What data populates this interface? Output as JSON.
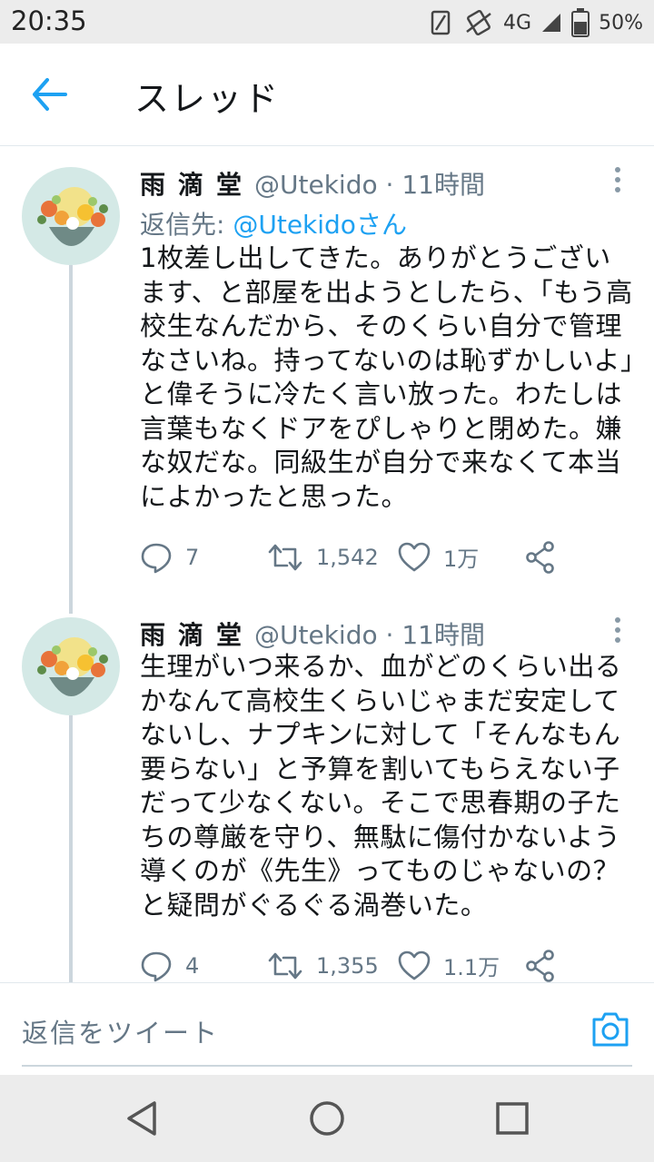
{
  "status_bar": {
    "time": "20:35",
    "network": "4G",
    "battery": "50%"
  },
  "header": {
    "title": "スレッド"
  },
  "tweets": [
    {
      "name": "雨滴堂",
      "meta": "@Utekido · 11時間",
      "reply_label": "返信先:",
      "reply_handle": "@Utekidoさん",
      "text": "1枚差し出してきた。ありがとうございます、と部屋を出ようとしたら、「もう高校生なんだから、そのくらい自分で管理なさいね。持ってないのは恥ずかしいよ」と偉そうに冷たく言い放った。わたしは言葉もなくドアをぴしゃりと閉めた。嫌な奴だな。同級生が自分で来なくて本当によかったと思った。",
      "replies": "7",
      "retweets": "1,542",
      "likes": "1万"
    },
    {
      "name": "雨滴堂",
      "meta": "@Utekido · 11時間",
      "text": "生理がいつ来るか、血がどのくらい出るかなんて高校生くらいじゃまだ安定してないし、ナプキンに対して「そんなもん要らない」と予算を割いてもらえない子だって少なくない。そこで思春期の子たちの尊厳を守り、無駄に傷付かないよう導くのが《先生》ってものじゃないの？と疑問がぐるぐる渦巻いた。",
      "replies": "4",
      "retweets": "1,355",
      "likes": "1.1万"
    }
  ],
  "composer": {
    "placeholder": "返信をツイート"
  },
  "colors": {
    "accent": "#1da1f2",
    "secondary_text": "#657786",
    "divider": "#e1e8ed"
  },
  "icons": [
    "back-arrow-icon",
    "reply-icon",
    "retweet-icon",
    "like-icon",
    "share-icon",
    "camera-icon",
    "more-icon"
  ]
}
